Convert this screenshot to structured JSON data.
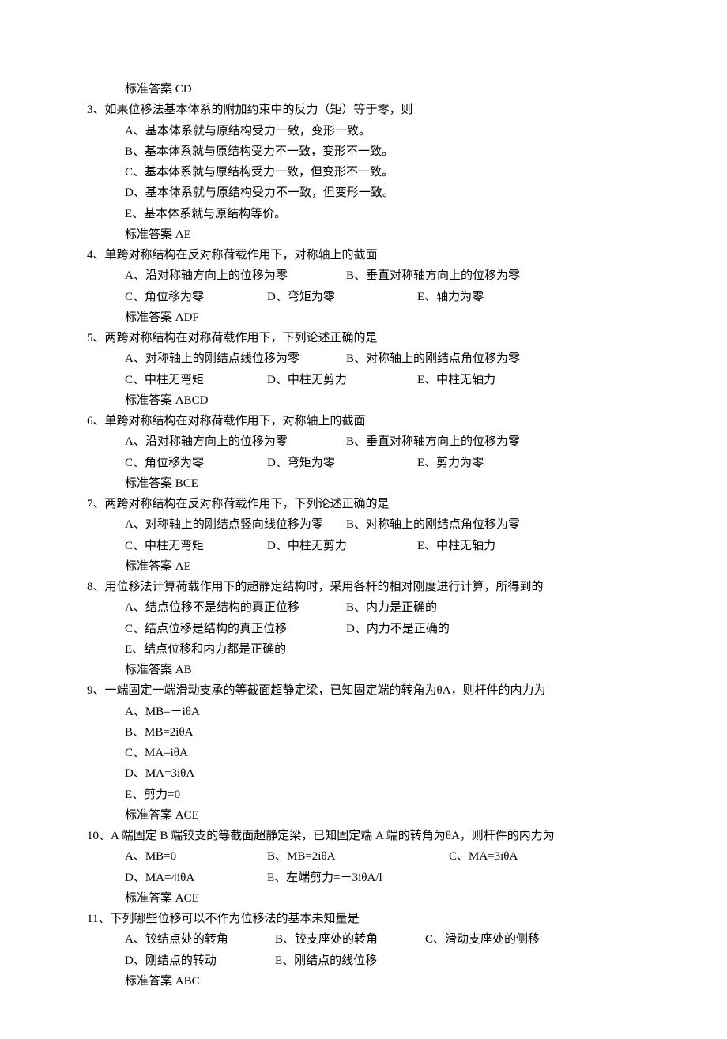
{
  "q2": {
    "answer_label": "标准答案 CD"
  },
  "q3": {
    "stem": "3、如果位移法基本体系的附加约束中的反力（矩）等于零，则",
    "opts": [
      "A、基本体系就与原结构受力一致，变形一致。",
      "B、基本体系就与原结构受力不一致，变形不一致。",
      "C、基本体系就与原结构受力一致，但变形不一致。",
      "D、基本体系就与原结构受力不一致，但变形一致。",
      "E、基本体系就与原结构等价。"
    ],
    "answer_label": "标准答案 AE"
  },
  "q4": {
    "stem": "4、单跨对称结构在反对称荷载作用下，对称轴上的截面",
    "row1": {
      "a": "A、沿对称轴方向上的位移为零",
      "b": "B、垂直对称轴方向上的位移为零"
    },
    "row2": {
      "c": "C、角位移为零",
      "d": "D、弯矩为零",
      "e": "E、轴力为零"
    },
    "answer_label": "标准答案 ADF"
  },
  "q5": {
    "stem": "5、两跨对称结构在对称荷载作用下，下列论述正确的是",
    "row1": {
      "a": "A、对称轴上的刚结点线位移为零",
      "b": "B、对称轴上的刚结点角位移为零"
    },
    "row2": {
      "c": "C、中柱无弯矩",
      "d": "D、中柱无剪力",
      "e": "E、中柱无轴力"
    },
    "answer_label": "标准答案 ABCD"
  },
  "q6": {
    "stem": "6、单跨对称结构在对称荷载作用下，对称轴上的截面",
    "row1": {
      "a": "A、沿对称轴方向上的位移为零",
      "b": "B、垂直对称轴方向上的位移为零"
    },
    "row2": {
      "c": "C、角位移为零",
      "d": "D、弯矩为零",
      "e": "E、剪力为零"
    },
    "answer_label": "标准答案 BCE"
  },
  "q7": {
    "stem": "7、两跨对称结构在反对称荷载作用下，下列论述正确的是",
    "row1": {
      "a": "A、对称轴上的刚结点竖向线位移为零",
      "b": "B、对称轴上的刚结点角位移为零"
    },
    "row2": {
      "c": "C、中柱无弯矩",
      "d": "D、中柱无剪力",
      "e": "E、中柱无轴力"
    },
    "answer_label": "标准答案 AE"
  },
  "q8": {
    "stem": "8、用位移法计算荷载作用下的超静定结构时，采用各杆的相对刚度进行计算，所得到的",
    "row1": {
      "a": "A、结点位移不是结构的真正位移",
      "b": "B、内力是正确的"
    },
    "row2": {
      "c": "C、结点位移是结构的真正位移",
      "d": "D、内力不是正确的"
    },
    "row3": {
      "e": "E、结点位移和内力都是正确的"
    },
    "answer_label": "标准答案 AB"
  },
  "q9": {
    "stem": "9、一端固定一端滑动支承的等截面超静定梁，已知固定端的转角为θA，则杆件的内力为",
    "opts": [
      "A、MB=－iθA",
      "B、MB=2iθA",
      "C、MA=iθA",
      "D、MA=3iθA",
      "E、剪力=0"
    ],
    "answer_label": "标准答案 ACE"
  },
  "q10": {
    "stem": "10、A 端固定 B 端铰支的等截面超静定梁，已知固定端 A 端的转角为θA，则杆件的内力为",
    "row1": {
      "a": "A、MB=0",
      "b": "B、MB=2iθA",
      "c": "C、MA=3iθA"
    },
    "row2": {
      "d": "D、MA=4iθA",
      "e": "E、左端剪力=－3iθA/l"
    },
    "answer_label": "标准答案 ACE"
  },
  "q11": {
    "stem": "11、下列哪些位移可以不作为位移法的基本未知量是",
    "row1": {
      "a": "A、铰结点处的转角",
      "b": "B、铰支座处的转角",
      "c": "C、滑动支座处的侧移"
    },
    "row2": {
      "d": "D、刚结点的转动",
      "e": "E、刚结点的线位移"
    },
    "answer_label": "标准答案 ABC"
  }
}
